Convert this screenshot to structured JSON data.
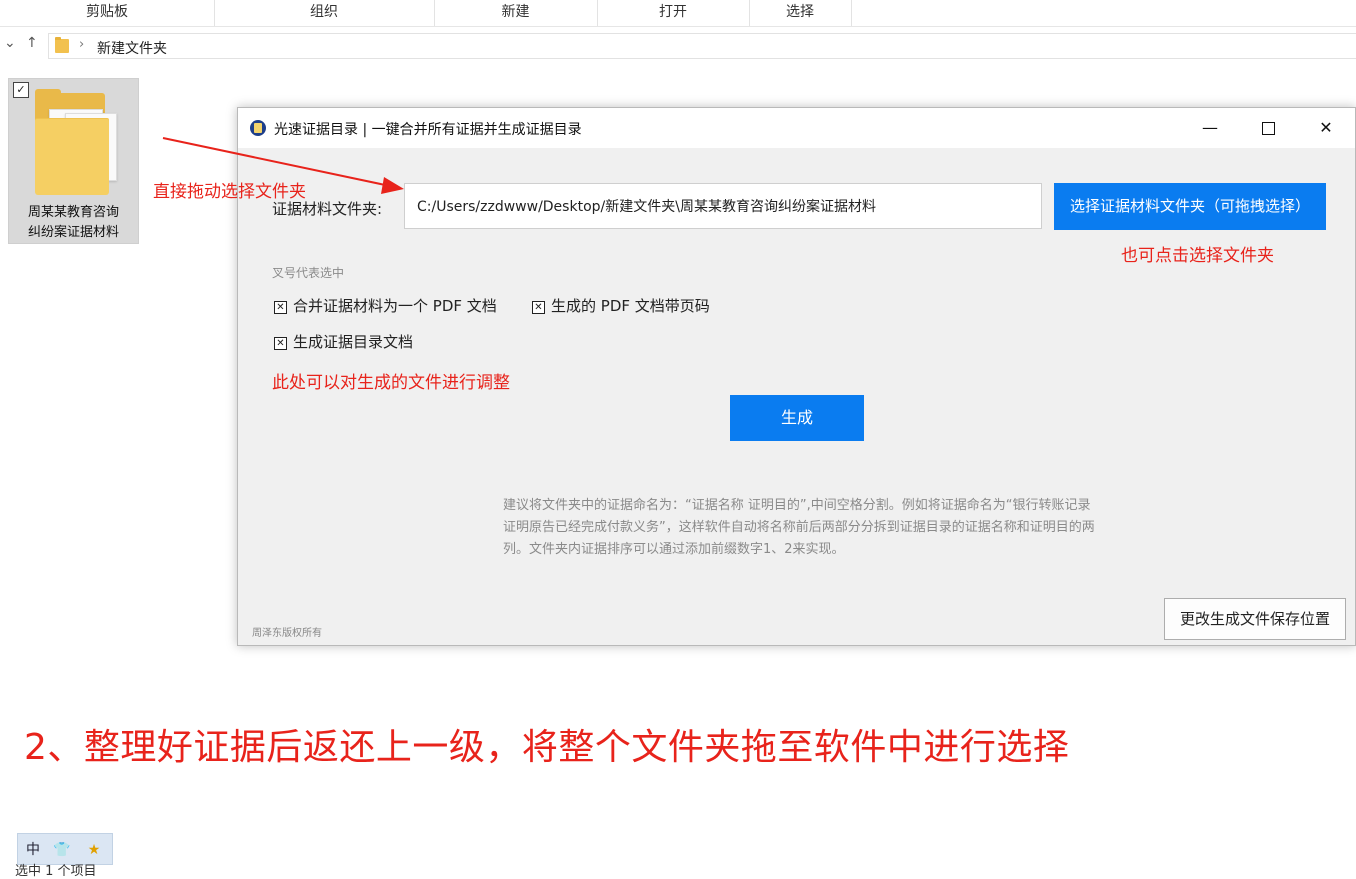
{
  "ribbon": {
    "groups": [
      "剪贴板",
      "组织",
      "新建",
      "打开",
      "选择"
    ]
  },
  "address_bar": {
    "back_glyph": "⌄",
    "up_glyph": "↑",
    "separator": "›",
    "current_folder": "新建文件夹"
  },
  "folder_tile": {
    "check_glyph": "✓",
    "name_line1": "周某某教育咨询",
    "name_line2": "纠纷案证据材料"
  },
  "annotations": {
    "drag_hint": "直接拖动选择文件夹",
    "click_hint": "也可点击选择文件夹",
    "adjust_hint": "此处可以对生成的文件进行调整",
    "step_caption": "2、整理好证据后返还上一级，将整个文件夹拖至软件中进行选择"
  },
  "app": {
    "title": "光速证据目录 | 一键合并所有证据并生成证据目录",
    "min_glyph": "—",
    "close_glyph": "✕",
    "path_label": "证据材料文件夹:",
    "path_value": "C:/Users/zzdwww/Desktop/新建文件夹\\周某某教育咨询纠纷案证据材料",
    "pick_button": "选择证据材料文件夹（可拖拽选择）",
    "checked_hint": "叉号代表选中",
    "check_glyph": "✕",
    "options": [
      "合并证据材料为一个 PDF 文档",
      "生成的 PDF 文档带页码",
      "生成证据目录文档"
    ],
    "generate_button": "生成",
    "advice": "建议将文件夹中的证据命名为：“证据名称 证明目的”,中间空格分割。例如将证据命名为“银行转账记录  证明原告已经完成付款义务”，这样软件自动将名称前后两部分分拆到证据目录的证据名称和证明目的两列。文件夹内证据排序可以通过添加前缀数字1、2来实现。",
    "copyright": "周泽东版权所有",
    "save_location_button": "更改生成文件保存位置"
  },
  "ime": {
    "mode": "中",
    "skin_glyph": "👕",
    "star_glyph": "★"
  },
  "status_bar": {
    "selection": "选中 1 个项目"
  },
  "colors": {
    "accent_blue": "#0a7cf0",
    "annotation_red": "#e8231b",
    "folder_yellow": "#f5cf63",
    "pdf_red": "#e5262b"
  }
}
